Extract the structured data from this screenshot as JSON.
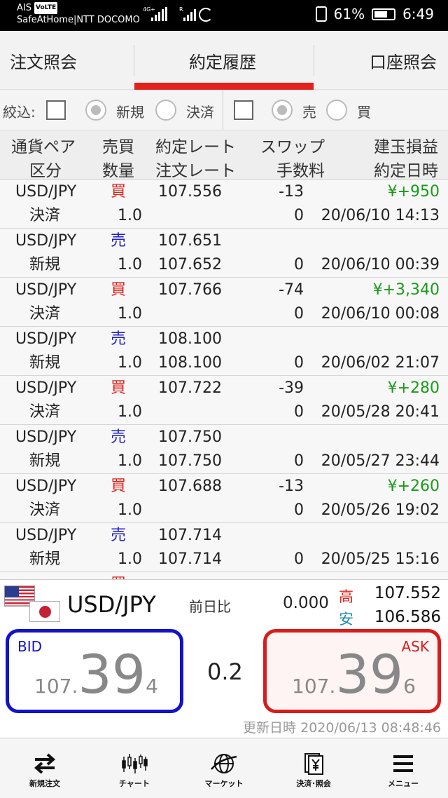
{
  "status_bar": {
    "carrier": "AIS",
    "volte": "VoLTE",
    "network_line": "SafeAtHome|NTT DOCOMO",
    "net_tag1": "4G+",
    "net_tag2": "R",
    "battery": "61%",
    "time": "6:49"
  },
  "tabs": [
    {
      "label": "注文照会"
    },
    {
      "label": "約定履歴",
      "active": true
    },
    {
      "label": "口座照会"
    }
  ],
  "filter": {
    "label": "絞込:",
    "new_label": "新規",
    "settle_label": "決済",
    "sell_label": "売",
    "buy_label": "買",
    "new_selected": true,
    "sell_selected": true
  },
  "table_header": {
    "col1_line1": "通貨ペア",
    "col1_line2": "区分",
    "col2_line1": "売買",
    "col2_line2": "数量",
    "col3_line1": "約定レート",
    "col3_line2": "注文レート",
    "col4_line1": "スワップ",
    "col4_line2": "手数料",
    "col5_line1": "建玉損益",
    "col5_line2": "約定日時"
  },
  "rows": [
    {
      "pair": "USD/JPY",
      "side": "買",
      "rate": "107.556",
      "swap": "-13",
      "pl": "¥+950",
      "type": "決済",
      "qty": "1.0",
      "order_rate": "",
      "fee": "0",
      "datetime": "20/06/10 14:13"
    },
    {
      "pair": "USD/JPY",
      "side": "売",
      "rate": "107.651",
      "swap": "",
      "pl": "",
      "type": "新規",
      "qty": "1.0",
      "order_rate": "107.652",
      "fee": "0",
      "datetime": "20/06/10 00:39"
    },
    {
      "pair": "USD/JPY",
      "side": "買",
      "rate": "107.766",
      "swap": "-74",
      "pl": "¥+3,340",
      "type": "決済",
      "qty": "1.0",
      "order_rate": "",
      "fee": "0",
      "datetime": "20/06/10 00:08"
    },
    {
      "pair": "USD/JPY",
      "side": "売",
      "rate": "108.100",
      "swap": "",
      "pl": "",
      "type": "新規",
      "qty": "1.0",
      "order_rate": "108.100",
      "fee": "0",
      "datetime": "20/06/02 21:07"
    },
    {
      "pair": "USD/JPY",
      "side": "買",
      "rate": "107.722",
      "swap": "-39",
      "pl": "¥+280",
      "type": "決済",
      "qty": "1.0",
      "order_rate": "",
      "fee": "0",
      "datetime": "20/05/28 20:41"
    },
    {
      "pair": "USD/JPY",
      "side": "売",
      "rate": "107.750",
      "swap": "",
      "pl": "",
      "type": "新規",
      "qty": "1.0",
      "order_rate": "107.750",
      "fee": "0",
      "datetime": "20/05/27 23:44"
    },
    {
      "pair": "USD/JPY",
      "side": "買",
      "rate": "107.688",
      "swap": "-13",
      "pl": "¥+260",
      "type": "決済",
      "qty": "1.0",
      "order_rate": "",
      "fee": "0",
      "datetime": "20/05/26 19:02"
    },
    {
      "pair": "USD/JPY",
      "side": "売",
      "rate": "107.714",
      "swap": "",
      "pl": "",
      "type": "新規",
      "qty": "1.0",
      "order_rate": "107.714",
      "fee": "0",
      "datetime": "20/05/25 15:16"
    },
    {
      "pair": "",
      "side": "買",
      "rate": "",
      "swap": "",
      "pl": "",
      "type": "",
      "qty": "",
      "order_rate": "",
      "fee": "",
      "datetime": ""
    }
  ],
  "quote": {
    "pair": "USD/JPY",
    "prev_label": "前日比",
    "prev_value": "0.000",
    "high_label": "高",
    "high_value": "107.552",
    "low_label": "安",
    "low_value": "106.586",
    "bid_label": "BID",
    "bid_prefix": "107.",
    "bid_big": "39",
    "bid_small": "4",
    "ask_label": "ASK",
    "ask_prefix": "107.",
    "ask_big": "39",
    "ask_small": "6",
    "spread": "0.2",
    "updated_label": "更新日時",
    "updated_value": "2020/06/13 08:48:46"
  },
  "nav": [
    {
      "label": "新規注文",
      "icon": "arrows-exchange-icon"
    },
    {
      "label": "チャート",
      "icon": "candlestick-chart-icon"
    },
    {
      "label": "マーケット",
      "icon": "globe-icon"
    },
    {
      "label": "決済･照会",
      "icon": "document-yen-icon"
    },
    {
      "label": "メニュー",
      "icon": "hamburger-menu-icon"
    }
  ]
}
